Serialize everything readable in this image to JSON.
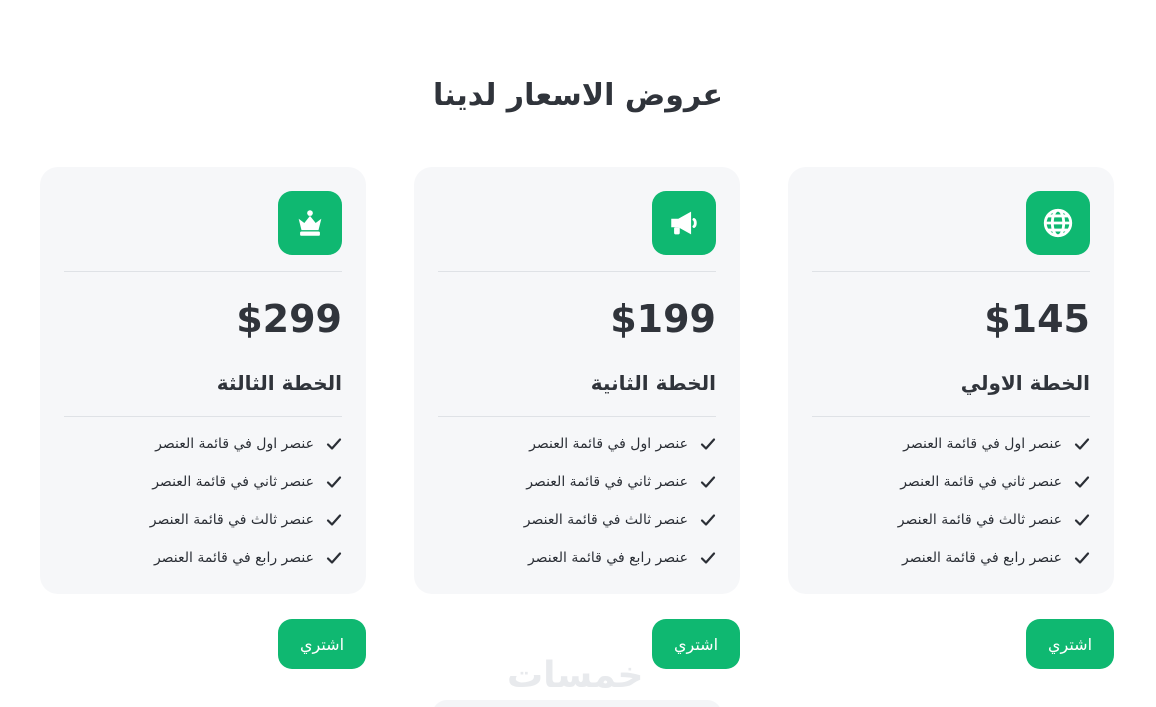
{
  "page": {
    "title": "عروض الاسعار لدينا",
    "watermark": "خمسات"
  },
  "plans": [
    {
      "icon": "globe-icon",
      "price": "$145",
      "name": "الخطة الاولي",
      "features": [
        "عنصر اول في قائمة العنصر",
        "عنصر ثاني في قائمة العنصر",
        "عنصر ثالث في قائمة العنصر",
        "عنصر رابع في قائمة العنصر"
      ],
      "button_label": "اشتري"
    },
    {
      "icon": "megaphone-icon",
      "price": "$199",
      "name": "الخطة الثانية",
      "features": [
        "عنصر اول في قائمة العنصر",
        "عنصر ثاني في قائمة العنصر",
        "عنصر ثالث في قائمة العنصر",
        "عنصر رابع في قائمة العنصر"
      ],
      "button_label": "اشتري"
    },
    {
      "icon": "crown-icon",
      "price": "$299",
      "name": "الخطة الثالثة",
      "features": [
        "عنصر اول في قائمة العنصر",
        "عنصر ثاني في قائمة العنصر",
        "عنصر ثالث في قائمة العنصر",
        "عنصر رابع في قائمة العنصر"
      ],
      "button_label": "اشتري"
    }
  ],
  "colors": {
    "accent": "#0fb871",
    "card_bg": "#f6f7f9",
    "text": "#30343b"
  }
}
